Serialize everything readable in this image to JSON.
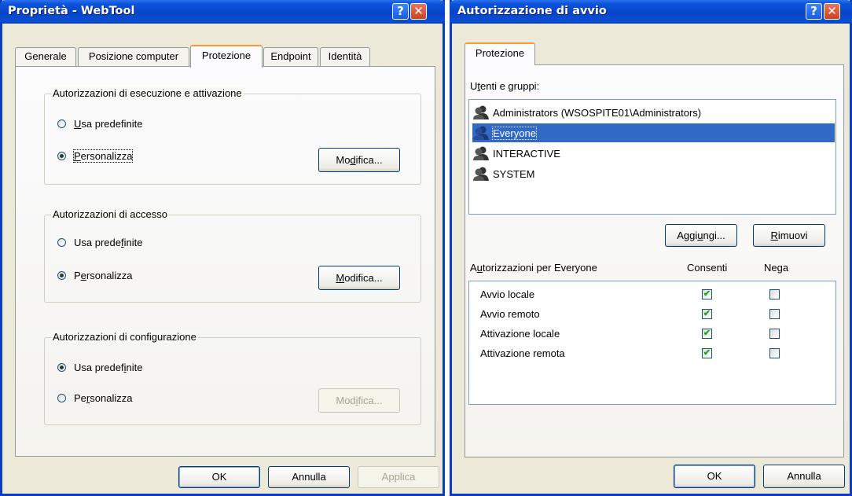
{
  "left_window": {
    "title": "Proprietà - WebTool",
    "help_glyph": "?",
    "close_glyph": "✕",
    "tabs": [
      "Generale",
      "Posizione computer",
      "Protezione",
      "Endpoint",
      "Identità"
    ],
    "active_tab": "Protezione",
    "groups": [
      {
        "legend": "Autorizzazioni di esecuzione e attivazione",
        "radio_default": {
          "pre": "",
          "ul": "U",
          "post": "sa predefinite"
        },
        "radio_custom": {
          "pre": "",
          "ul": "P",
          "post": "ersonalizza"
        },
        "selected": "custom",
        "edit_button": {
          "pre": "Mo",
          "ul": "d",
          "post": "ifica..."
        },
        "edit_enabled": true
      },
      {
        "legend": "Autorizzazioni di accesso",
        "radio_default": {
          "pre": "Usa prede",
          "ul": "f",
          "post": "inite"
        },
        "radio_custom": {
          "pre": "P",
          "ul": "e",
          "post": "rsonalizza"
        },
        "selected": "custom",
        "edit_button": {
          "pre": "",
          "ul": "M",
          "post": "odifica..."
        },
        "edit_enabled": true
      },
      {
        "legend": "Autorizzazioni di configurazione",
        "radio_default": {
          "pre": "Usa predef",
          "ul": "i",
          "post": "nite"
        },
        "radio_custom": {
          "pre": "Pe",
          "ul": "r",
          "post": "sonalizza"
        },
        "selected": "default",
        "edit_button": {
          "pre": "Mod",
          "ul": "i",
          "post": "fica..."
        },
        "edit_enabled": false
      }
    ],
    "buttons": {
      "ok": "OK",
      "cancel": "Annulla",
      "apply": "Applica"
    }
  },
  "right_window": {
    "title": "Autorizzazione di avvio",
    "help_glyph": "?",
    "close_glyph": "✕",
    "tab": "Protezione",
    "users_label": {
      "pre": "U",
      "ul": "t",
      "post": "enti e gruppi:"
    },
    "users": [
      {
        "name": "Administrators (WSOSPITE01\\Administrators)",
        "selected": false
      },
      {
        "name": "Everyone",
        "selected": true
      },
      {
        "name": "INTERACTIVE",
        "selected": false
      },
      {
        "name": "SYSTEM",
        "selected": false
      }
    ],
    "add_button": {
      "pre": "Aggi",
      "ul": "u",
      "post": "ngi..."
    },
    "remove_button": {
      "pre": "",
      "ul": "R",
      "post": "imuovi"
    },
    "perm_label": {
      "pre": "A",
      "ul": "u",
      "post": "torizzazioni per Everyone"
    },
    "col_allow": "Consenti",
    "col_deny": "Nega",
    "permissions": [
      {
        "name": "Avvio locale",
        "allow": true,
        "deny": false
      },
      {
        "name": "Avvio remoto",
        "allow": true,
        "deny": false
      },
      {
        "name": "Attivazione locale",
        "allow": true,
        "deny": false
      },
      {
        "name": "Attivazione remota",
        "allow": true,
        "deny": false
      }
    ],
    "buttons": {
      "ok": "OK",
      "cancel": "Annulla"
    },
    "check_glyph": "✔"
  }
}
